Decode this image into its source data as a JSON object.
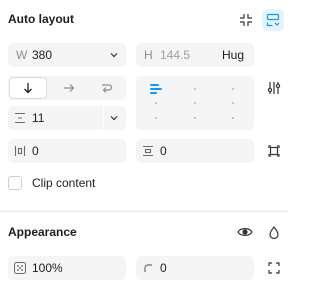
{
  "auto_layout": {
    "title": "Auto layout",
    "width": {
      "label": "W",
      "value": "380"
    },
    "height": {
      "label": "H",
      "value": "144.5",
      "mode": "Hug"
    },
    "gap": {
      "value": "11"
    },
    "padding_horizontal": {
      "value": "0"
    },
    "padding_vertical": {
      "value": "0"
    },
    "clip_content_label": "Clip content"
  },
  "appearance": {
    "title": "Appearance",
    "opacity": {
      "value": "100%"
    },
    "corner_radius": {
      "value": "0"
    }
  },
  "colors": {
    "accent": "#0d99ff",
    "field_bg": "#f5f5f5",
    "divider": "#e6e6e6"
  }
}
